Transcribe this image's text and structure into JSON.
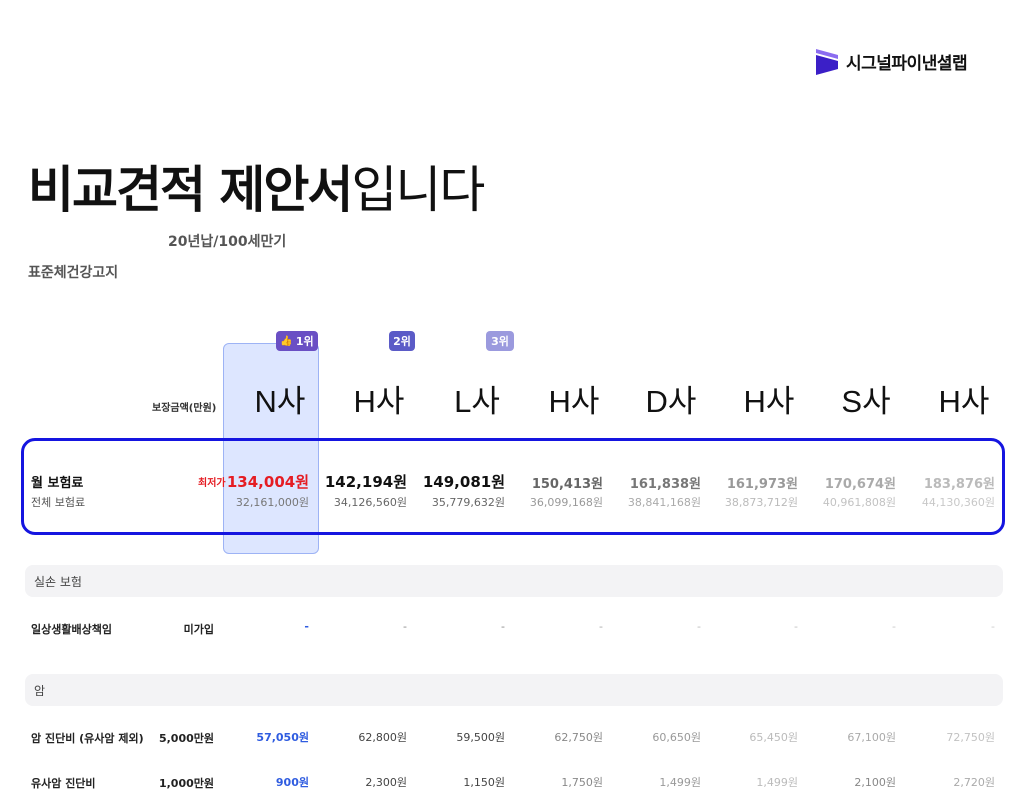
{
  "brand": {
    "name": "시그널파이낸셜랩",
    "colors": {
      "logo_dark": "#3b1fc7",
      "logo_light": "#8b6cf0"
    }
  },
  "title": {
    "bold": "비교견적 제안서",
    "light": "입니다"
  },
  "subtitle": "20년납/100세만기",
  "notice": "표준체건강고지",
  "ranks": [
    {
      "icon": "thumbs-up-icon",
      "label": "1위"
    },
    {
      "label": "2위"
    },
    {
      "label": "3위"
    }
  ],
  "coverage_header": "보장금액(만원)",
  "companies": [
    "N사",
    "H사",
    "L사",
    "H사",
    "D사",
    "H사",
    "S사",
    "H사"
  ],
  "premium": {
    "monthly_label": "월 보험료",
    "total_label": "전체 보험료",
    "lowest_tag": "최저가",
    "monthly": [
      "134,004원",
      "142,194원",
      "149,081원",
      "150,413원",
      "161,838원",
      "161,973원",
      "170,674원",
      "183,876원"
    ],
    "total": [
      "32,161,000원",
      "34,126,560원",
      "35,779,632원",
      "36,099,168원",
      "38,841,168원",
      "38,873,712원",
      "40,961,808원",
      "44,130,360원"
    ]
  },
  "sections": [
    {
      "title": "실손 보험",
      "rows": [
        {
          "label": "일상생활배상책임",
          "amount": "미가입",
          "values": [
            "-",
            "-",
            "-",
            "-",
            "-",
            "-",
            "-",
            "-"
          ]
        }
      ]
    },
    {
      "title": "암",
      "rows": [
        {
          "label": "암 진단비 (유사암 제외)",
          "amount": "5,000만원",
          "values": [
            "57,050원",
            "62,800원",
            "59,500원",
            "62,750원",
            "60,650원",
            "65,450원",
            "67,100원",
            "72,750원"
          ]
        },
        {
          "label": "유사암 진단비",
          "amount": "1,000만원",
          "values": [
            "900원",
            "2,300원",
            "1,150원",
            "1,750원",
            "1,499원",
            "1,499원",
            "2,100원",
            "2,720원"
          ]
        }
      ]
    }
  ],
  "colors": {
    "accent": "#1515e0",
    "lowest": "#e51c23",
    "winner_value": "#2f5ce0",
    "winner_bg": "#dde6ff"
  }
}
